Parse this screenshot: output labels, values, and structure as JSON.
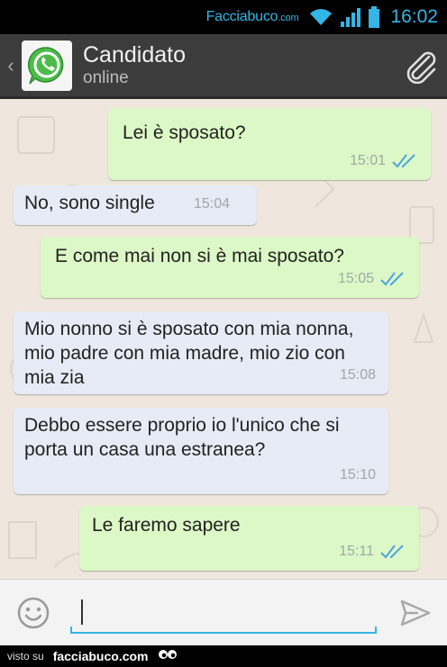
{
  "status": {
    "brand": "Facciabuco",
    "brand_suffix": ".com",
    "time": "16:02"
  },
  "header": {
    "back_glyph": "‹",
    "contact_name": "Candidato",
    "contact_status": "online",
    "app_icon": "whatsapp-icon",
    "attach_icon": "paperclip-icon"
  },
  "messages": [
    {
      "direction": "out",
      "text": "Lei è sposato?",
      "time": "15:01",
      "read": true
    },
    {
      "direction": "in",
      "text": "No, sono single",
      "time": "15:04"
    },
    {
      "direction": "out",
      "text": "E come mai non si è mai sposato?",
      "time": "15:05",
      "read": true
    },
    {
      "direction": "in",
      "text": "Mio nonno si è sposato con mia nonna, mio padre con mia madre, mio zio con mia zia",
      "time": "15:08"
    },
    {
      "direction": "in",
      "text": "Debbo essere proprio io l'unico che si porta un casa una estranea?",
      "time": "15:10"
    },
    {
      "direction": "out",
      "text": "Le faremo sapere",
      "time": "15:11",
      "read": true
    }
  ],
  "composer": {
    "value": "",
    "placeholder": "",
    "emoji_icon": "smiley-icon",
    "send_icon": "send-icon"
  },
  "footer": {
    "prefix": "visto su",
    "brand": "facciabuco.com"
  },
  "colors": {
    "accent": "#33b5e5",
    "outgoing_bubble": "#dcf8c6",
    "incoming_bubble": "#e7ebf5",
    "read_ticks": "#4fa3e0"
  }
}
